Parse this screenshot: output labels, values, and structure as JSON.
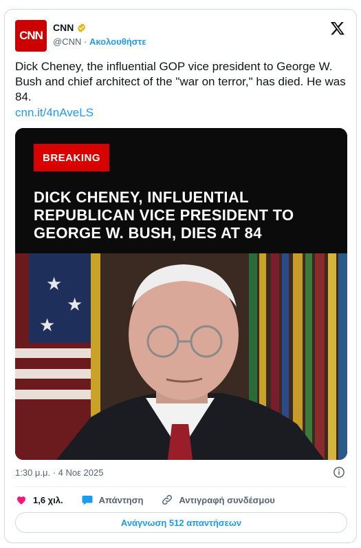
{
  "author": {
    "avatar_text": "CNN",
    "name": "CNN",
    "handle": "@CNN",
    "separator": "·",
    "follow_label": "Ακολουθήστε"
  },
  "tweet": {
    "text": "Dick Cheney, the influential GOP vice president to George W. Bush and chief architect of the \"war on terror,\" has died. He was 84.",
    "link": "cnn.it/4nAveLS"
  },
  "media": {
    "badge": "BREAKING",
    "headline": "DICK CHENEY, INFLUENTIAL REPUBLICAN VICE PRESIDENT TO GEORGE W. BUSH, DIES AT 84"
  },
  "meta": {
    "timestamp": "1:30 μ.μ. · 4 Νοε 2025"
  },
  "actions": {
    "likes": "1,6 χιλ.",
    "reply_label": "Απάντηση",
    "copy_link_label": "Αντιγραφή συνδέσμου"
  },
  "read_replies_label": "Ανάγνωση 512 απαντήσεων",
  "colors": {
    "accent": "#1d9bf0",
    "like": "#f91880",
    "brand_red": "#cc0000"
  },
  "icons": [
    "x-logo-icon",
    "verified-badge-icon",
    "info-icon",
    "heart-icon",
    "reply-bubble-icon",
    "link-icon"
  ]
}
